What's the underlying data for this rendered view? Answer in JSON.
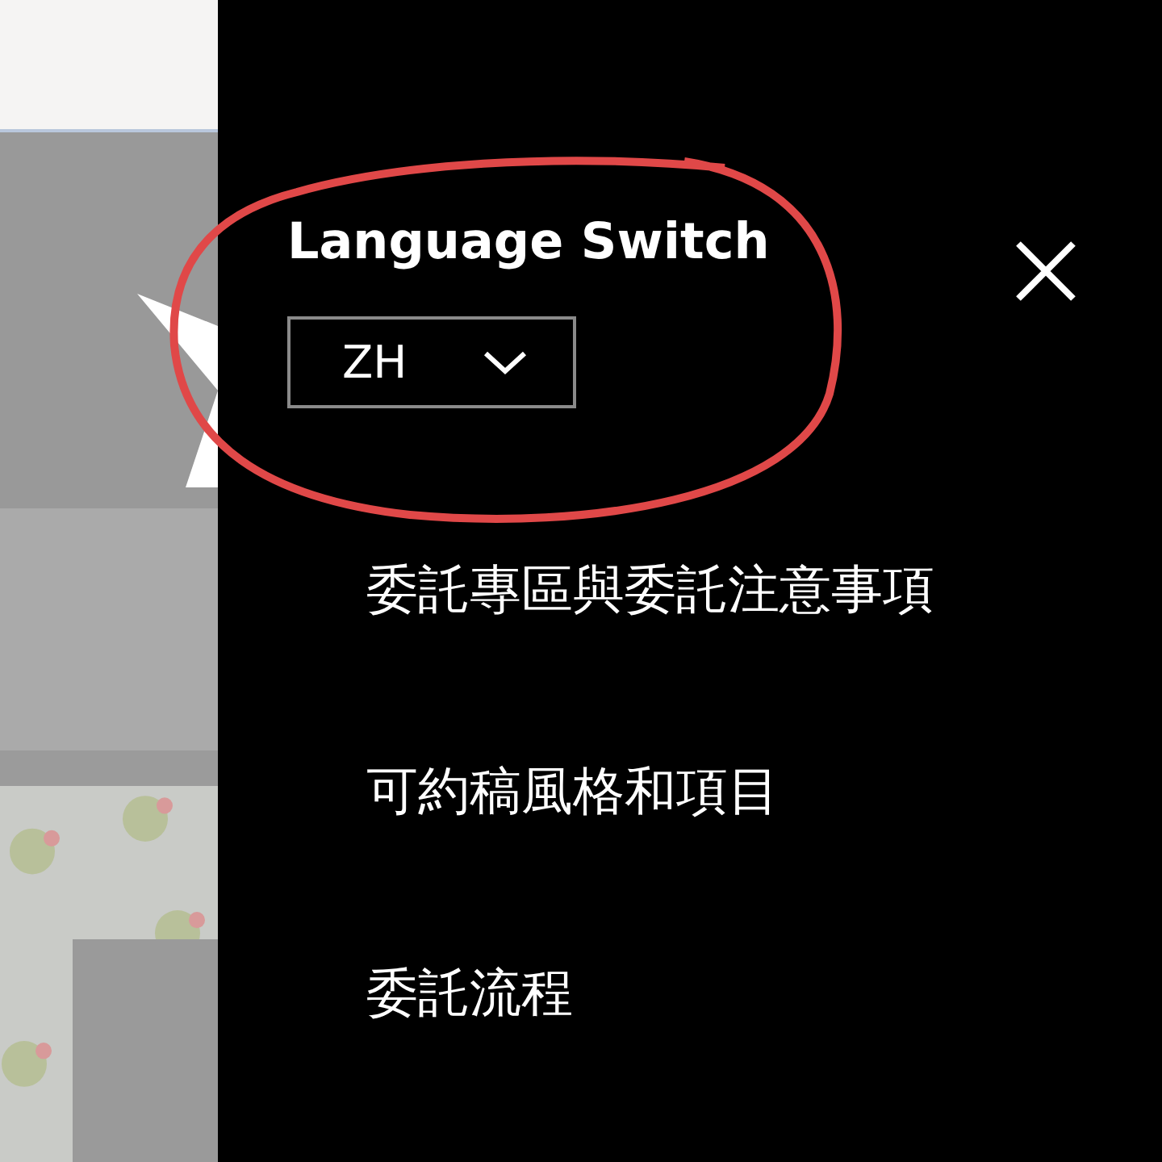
{
  "drawer": {
    "language_switch": {
      "title": "Language Switch",
      "value": "ZH"
    },
    "menu_items": [
      {
        "label": "委託專區與委託注意事項"
      },
      {
        "label": "可約稿風格和項目"
      },
      {
        "label": "委託流程"
      }
    ]
  }
}
